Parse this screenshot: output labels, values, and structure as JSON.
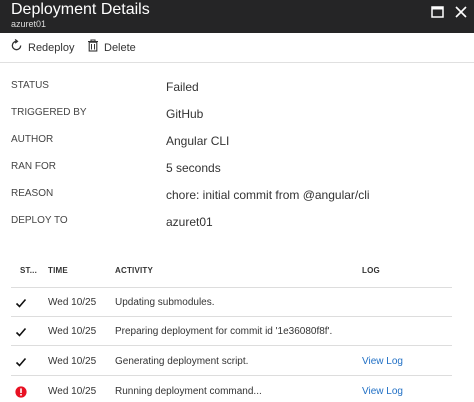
{
  "window": {
    "title": "Deployment Details",
    "subtitle": "azuret01",
    "maximize_icon": "maximize-icon",
    "close_icon": "close-icon"
  },
  "toolbar": {
    "redeploy_label": "Redeploy",
    "redeploy_icon": "refresh-icon",
    "delete_label": "Delete",
    "delete_icon": "trash-icon"
  },
  "properties": [
    {
      "label": "STATUS",
      "value": "Failed"
    },
    {
      "label": "TRIGGERED BY",
      "value": "GitHub"
    },
    {
      "label": "AUTHOR",
      "value": "Angular CLI"
    },
    {
      "label": "RAN FOR",
      "value": "5 seconds"
    },
    {
      "label": "REASON",
      "value": "chore: initial commit from @angular/cli"
    },
    {
      "label": "DEPLOY TO",
      "value": "azuret01"
    }
  ],
  "activity_table": {
    "columns": [
      "ST...",
      "TIME",
      "ACTIVITY",
      "LOG"
    ],
    "rows": [
      {
        "status": "success",
        "status_icon": "checkmark-icon",
        "time": "Wed 10/25",
        "activity": "Updating submodules.",
        "log": ""
      },
      {
        "status": "success",
        "status_icon": "checkmark-icon",
        "time": "Wed 10/25",
        "activity": "Preparing deployment for commit id '1e36080f8f'.",
        "log": ""
      },
      {
        "status": "success",
        "status_icon": "checkmark-icon",
        "time": "Wed 10/25",
        "activity": "Generating deployment script.",
        "log": "View Log"
      },
      {
        "status": "error",
        "status_icon": "error-icon",
        "time": "Wed 10/25",
        "activity": "Running deployment command...",
        "log": "View Log"
      }
    ]
  },
  "colors": {
    "titlebar_bg": "#252526",
    "link": "#1f6fc5",
    "error": "#e81123"
  }
}
